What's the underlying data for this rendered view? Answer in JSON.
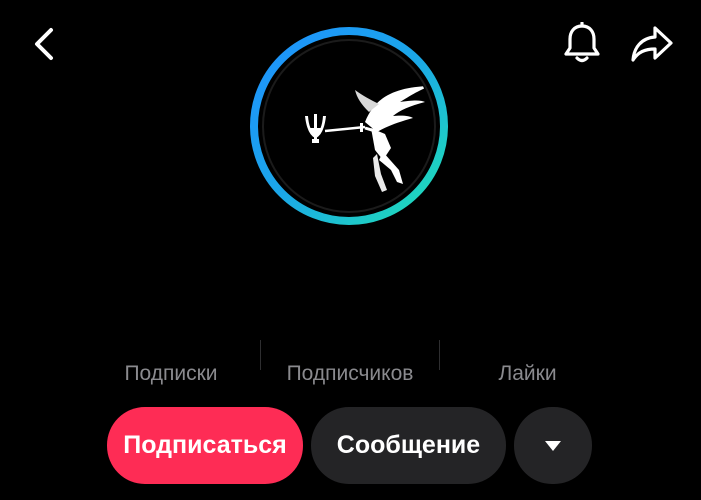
{
  "header": {
    "back_icon": "chevron-left-icon",
    "bell_icon": "bell-icon",
    "share_icon": "share-arrow-icon"
  },
  "profile": {
    "avatar_ring_colors": [
      "#1e90ff",
      "#20e3b2"
    ],
    "avatar_image": "winged-archangel-with-trident-emblem"
  },
  "stats": {
    "following_label": "Подписки",
    "followers_label": "Подписчиков",
    "likes_label": "Лайки"
  },
  "actions": {
    "follow_label": "Подписаться",
    "message_label": "Сообщение",
    "more_icon": "caret-down-icon"
  },
  "colors": {
    "background": "#000000",
    "accent": "#fe2c55",
    "secondary_button": "#242426",
    "muted_text": "#8a8a8e"
  }
}
